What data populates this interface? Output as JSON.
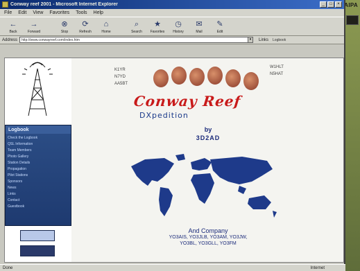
{
  "desktop": {
    "label": "AIPA"
  },
  "window": {
    "title": "Conway reef 2001 - Microsoft Internet Explorer",
    "controls": {
      "minimize": "_",
      "maximize": "□",
      "close": "×"
    }
  },
  "menubar": {
    "items": [
      "File",
      "Edit",
      "View",
      "Favorites",
      "Tools",
      "Help"
    ]
  },
  "toolbar": {
    "buttons": [
      {
        "label": "Back",
        "icon": "back-arrow-icon",
        "glyph": "←"
      },
      {
        "label": "Forward",
        "icon": "forward-arrow-icon",
        "glyph": "→"
      },
      {
        "label": "Stop",
        "icon": "stop-icon",
        "glyph": "⊗"
      },
      {
        "label": "Refresh",
        "icon": "refresh-icon",
        "glyph": "⟳"
      },
      {
        "label": "Home",
        "icon": "home-icon",
        "glyph": "⌂"
      },
      {
        "label": "Search",
        "icon": "search-icon",
        "glyph": "⌕"
      },
      {
        "label": "Favorites",
        "icon": "favorites-icon",
        "glyph": "★"
      },
      {
        "label": "History",
        "icon": "history-icon",
        "glyph": "◷"
      },
      {
        "label": "Mail",
        "icon": "mail-icon",
        "glyph": "✉"
      },
      {
        "label": "Edit",
        "icon": "edit-icon",
        "glyph": "✎"
      }
    ]
  },
  "addressbar": {
    "label": "Address",
    "value": "http://www.conwayreef.com/index.htm",
    "go_label": "Links",
    "links_value": "Logbook"
  },
  "sidebar": {
    "panel_title": "Logbook",
    "items": [
      "Check the Logbook",
      "QSL Information",
      "Team Members",
      "Photo Gallery",
      "Station Details",
      "Propagation",
      "Pilot Stations",
      "Sponsors",
      "News",
      "Links",
      "Contact",
      "Guestbook"
    ]
  },
  "main": {
    "calls_left": [
      "K1YR",
      "N7YD",
      "AA5BT"
    ],
    "calls_right": [
      "W1HLT",
      "N5HAT"
    ],
    "banner": "Conway Reef",
    "subtitle": "DXpedition",
    "by": "by",
    "callsign": "3D2AD",
    "dates": "",
    "company": "And Company",
    "ops_line1": "YO3AIS, YO3JLB, YO3AM, YO3JW,",
    "ops_line2": "YO3BL, YO3GLL, YO3FM",
    "footer": ""
  },
  "statusbar": {
    "left": "Done",
    "zone": "Internet"
  },
  "colors": {
    "accent": "#c81a1a",
    "link": "#1a2a7a",
    "titlebar": "#0a2a6e"
  }
}
